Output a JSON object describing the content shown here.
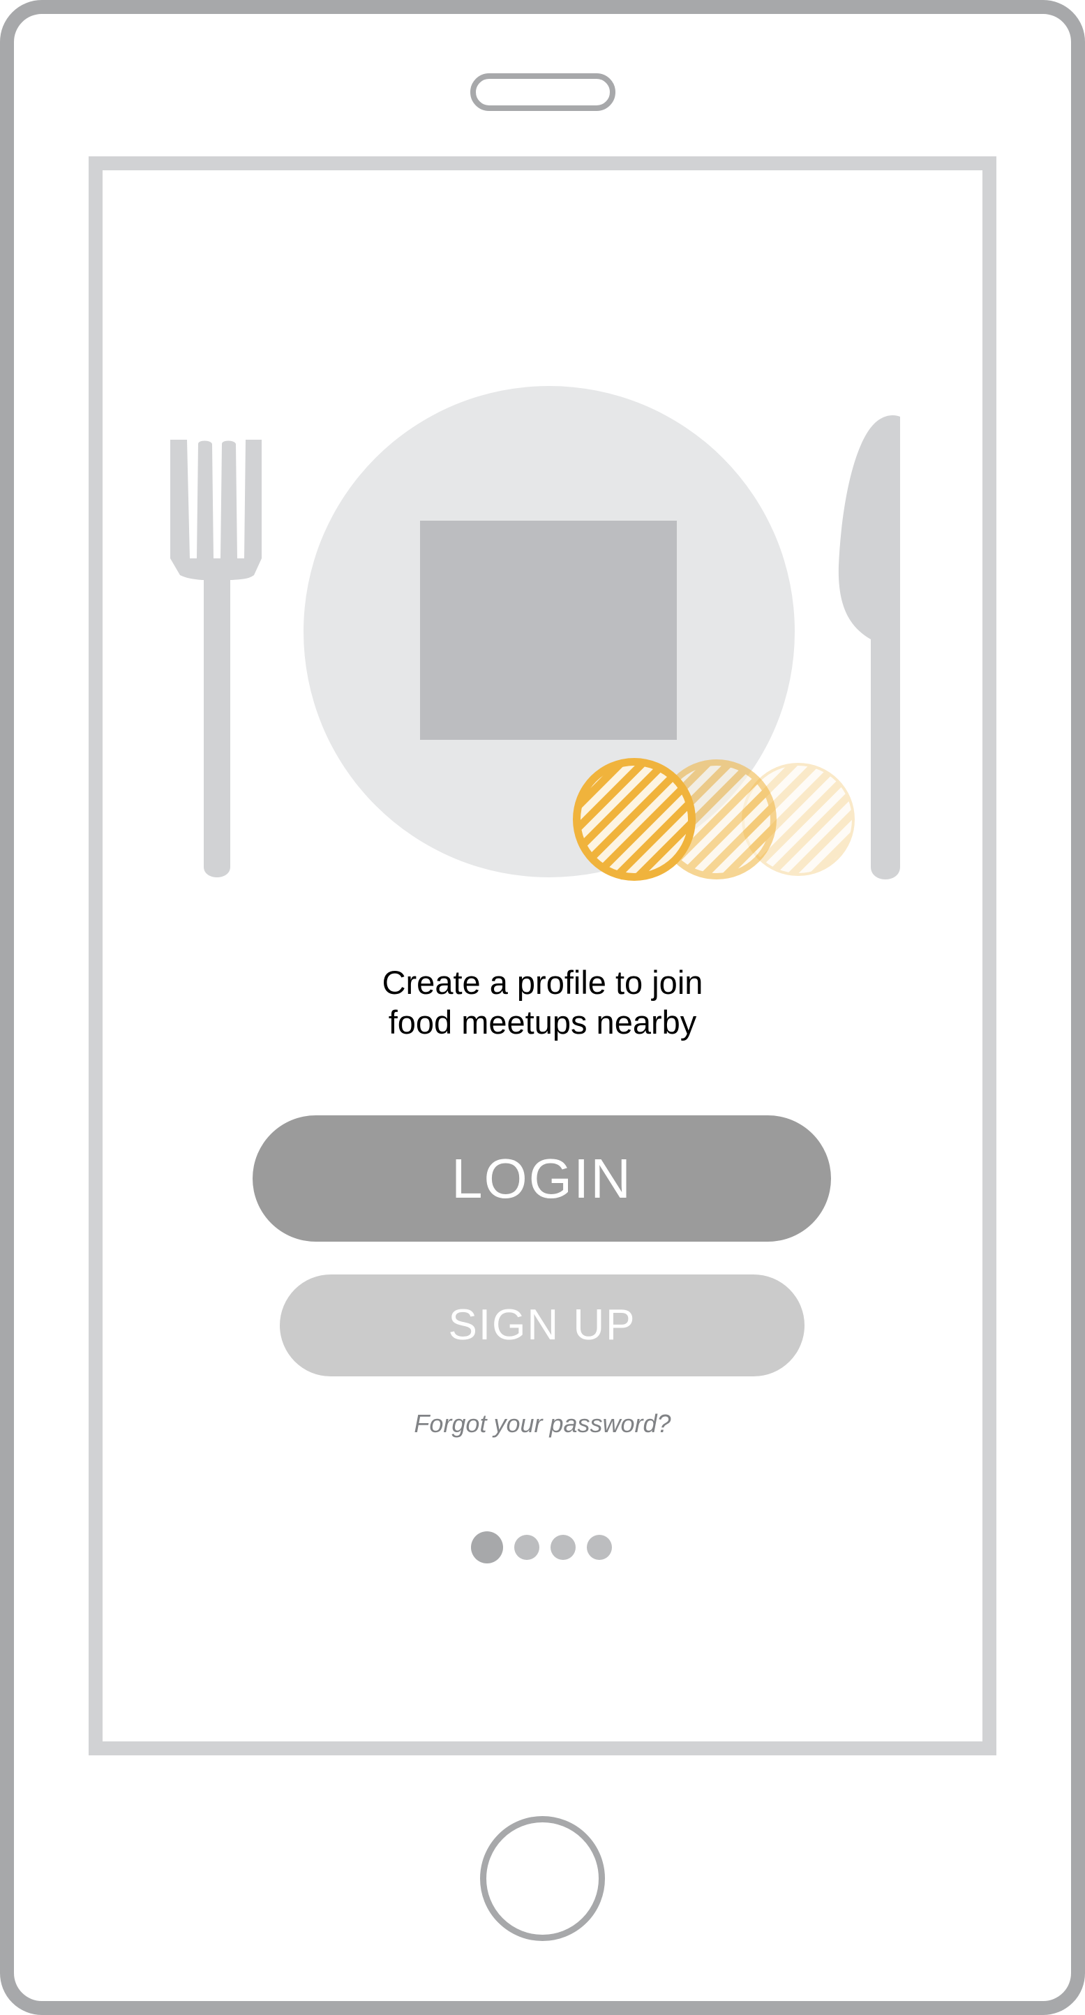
{
  "device": {
    "frame_color": "#a7a8aa",
    "screen_border_color": "#d1d2d4"
  },
  "hero": {
    "icons": [
      "fork-icon",
      "plate-icon",
      "knife-icon",
      "meetup-circles-icon"
    ],
    "plate_color": "#e6e7e8",
    "food_placeholder_color": "#bcbdc0",
    "utensil_color": "#d1d2d4",
    "accent_color": "#f0b33c"
  },
  "tagline": {
    "line1": "Create a profile to join",
    "line2": "food meetups nearby"
  },
  "actions": {
    "login_label": "LOGIN",
    "signup_label": "SIGN UP",
    "forgot_password": "Forgot your password?"
  },
  "pagination": {
    "total_pages": 4,
    "current_page": 1
  }
}
